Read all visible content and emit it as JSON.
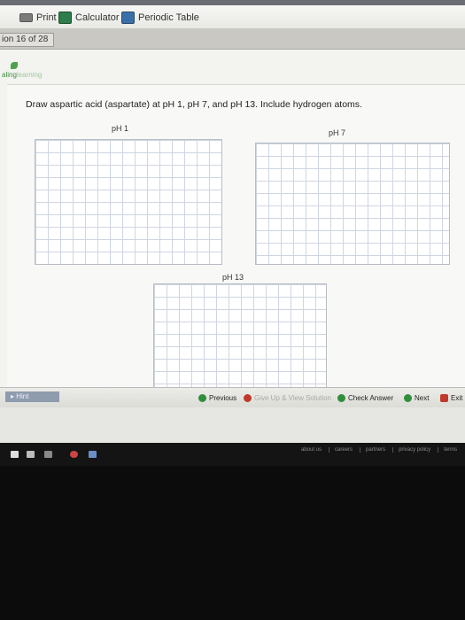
{
  "toolbar": {
    "print_label": "Print",
    "calculator_label": "Calculator",
    "periodic_table_label": "Periodic Table"
  },
  "question_bar": {
    "counter": "ion 16 of 28"
  },
  "logo": {
    "brand_left": "aling",
    "brand_right": "learning"
  },
  "question": {
    "prompt": "Draw aspartic acid (aspartate) at pH 1, pH 7, and pH 13. Include hydrogen atoms.",
    "canvases": [
      {
        "label": "pH 1"
      },
      {
        "label": "pH 7"
      },
      {
        "label": "pH 13"
      }
    ]
  },
  "nav": {
    "hint_label": "Hint",
    "previous_label": "Previous",
    "give_up_label": "Give Up & View Solution",
    "check_answer_label": "Check Answer",
    "next_label": "Next",
    "exit_label": "Exit"
  },
  "footer": {
    "links": [
      "about us",
      "careers",
      "partners",
      "privacy policy",
      "terms"
    ]
  }
}
